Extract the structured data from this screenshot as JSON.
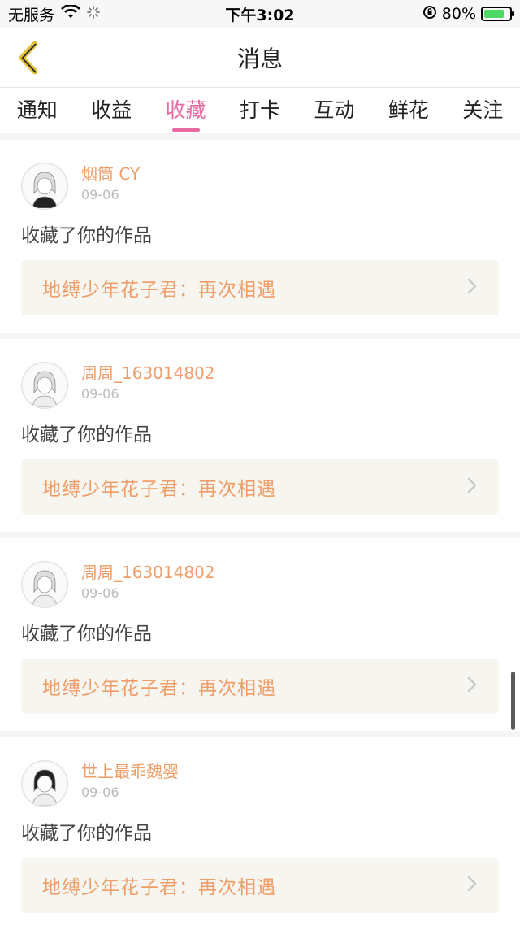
{
  "status_bar": {
    "carrier": "无服务",
    "time": "下午3:02",
    "battery_percent": "80%",
    "battery_level": 0.8
  },
  "nav": {
    "title": "消息"
  },
  "tabs": [
    {
      "label": "通知",
      "active": false
    },
    {
      "label": "收益",
      "active": false
    },
    {
      "label": "收藏",
      "active": true
    },
    {
      "label": "打卡",
      "active": false
    },
    {
      "label": "互动",
      "active": false
    },
    {
      "label": "鲜花",
      "active": false
    },
    {
      "label": "关注",
      "active": false
    }
  ],
  "messages": [
    {
      "username": "烟筒 CY",
      "date": "09-06",
      "action": "收藏了你的作品",
      "work_title": "地缚少年花子君：再次相遇"
    },
    {
      "username": "周周_163014802",
      "date": "09-06",
      "action": "收藏了你的作品",
      "work_title": "地缚少年花子君：再次相遇"
    },
    {
      "username": "周周_163014802",
      "date": "09-06",
      "action": "收藏了你的作品",
      "work_title": "地缚少年花子君：再次相遇"
    },
    {
      "username": "世上最乖魏婴",
      "date": "09-06",
      "action": "收藏了你的作品",
      "work_title": "地缚少年花子君：再次相遇"
    }
  ],
  "colors": {
    "accent": "#e76aa3",
    "username": "#ef9e6a",
    "back_arrow": "#e3c23a"
  }
}
